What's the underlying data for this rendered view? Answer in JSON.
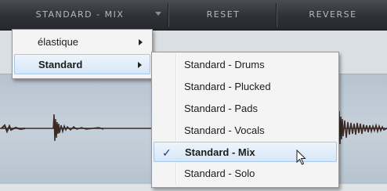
{
  "toolbar": {
    "preset_label": "STANDARD - MIX",
    "reset_label": "RESET",
    "reverse_label": "REVERSE"
  },
  "menu_main": {
    "items": [
      {
        "label": "élastique",
        "has_submenu": true,
        "highlighted": false
      },
      {
        "label": "Standard",
        "has_submenu": true,
        "highlighted": true
      }
    ]
  },
  "menu_sub": {
    "items": [
      {
        "label": "Standard - Drums",
        "checked": false
      },
      {
        "label": "Standard - Plucked",
        "checked": false
      },
      {
        "label": "Standard - Pads",
        "checked": false
      },
      {
        "label": "Standard - Vocals",
        "checked": false
      },
      {
        "label": "Standard - Mix",
        "checked": true
      },
      {
        "label": "Standard - Solo",
        "checked": false
      }
    ],
    "check_glyph": "✓"
  },
  "colors": {
    "toolbar_bg": "#303338",
    "toolbar_text": "#b4b8bc",
    "wave_band": "#c1ccd6",
    "waveform": "#3b2a24",
    "highlight": "#d5e6f7"
  },
  "icons": {
    "dropdown": "chevron-down-icon",
    "submenu": "chevron-right-icon",
    "check": "check-icon",
    "cursor": "mouse-pointer-icon"
  }
}
